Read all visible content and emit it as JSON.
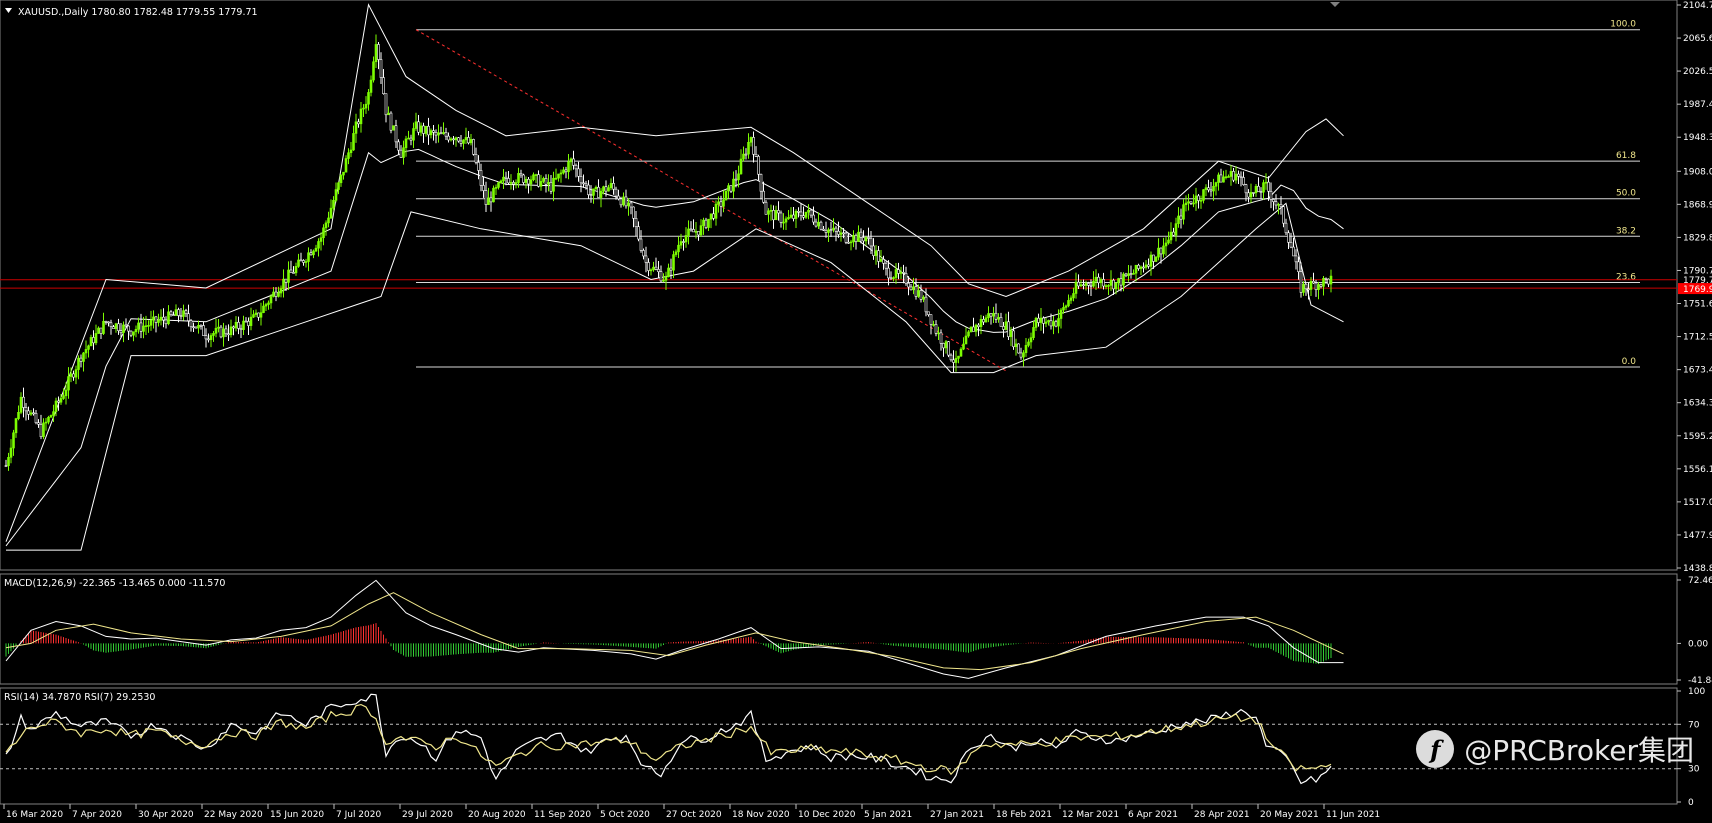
{
  "chart_data": [
    {
      "type": "candlestick",
      "title": "XAUUSD.,Daily  1780.80 1782.48 1779.55 1779.71",
      "ylim": [
        1438.85,
        2104.7
      ],
      "y_ticks": [
        "2104.70",
        "2065.60",
        "2026.55",
        "1987.40",
        "1948.30",
        "1908.05",
        "1868.95",
        "1829.85",
        "1790.75",
        "1751.65",
        "1712.55",
        "1673.45",
        "1634.35",
        "1595.25",
        "1556.15",
        "1517.05",
        "1477.95",
        "1438.85"
      ],
      "x_ticks": [
        "16 Mar 2020",
        "7 Apr 2020",
        "30 Apr 2020",
        "22 May 2020",
        "15 Jun 2020",
        "7 Jul 2020",
        "29 Jul 2020",
        "20 Aug 2020",
        "11 Sep 2020",
        "5 Oct 2020",
        "27 Oct 2020",
        "18 Nov 2020",
        "10 Dec 2020",
        "5 Jan 2021",
        "27 Jan 2021",
        "18 Feb 2021",
        "12 Mar 2021",
        "6 Apr 2021",
        "28 Apr 2021",
        "20 May 2021",
        "11 Jun 2021"
      ],
      "price_path": [
        [
          0,
          1560
        ],
        [
          6,
          1640
        ],
        [
          14,
          1600
        ],
        [
          22,
          1640
        ],
        [
          30,
          1690
        ],
        [
          40,
          1730
        ],
        [
          50,
          1720
        ],
        [
          60,
          1730
        ],
        [
          70,
          1740
        ],
        [
          80,
          1715
        ],
        [
          90,
          1720
        ],
        [
          100,
          1735
        ],
        [
          110,
          1775
        ],
        [
          118,
          1800
        ],
        [
          126,
          1830
        ],
        [
          134,
          1900
        ],
        [
          140,
          1960
        ],
        [
          145,
          2000
        ],
        [
          148,
          2065
        ],
        [
          152,
          1980
        ],
        [
          158,
          1930
        ],
        [
          164,
          1960
        ],
        [
          172,
          1950
        ],
        [
          180,
          1950
        ],
        [
          186,
          1940
        ],
        [
          192,
          1870
        ],
        [
          200,
          1900
        ],
        [
          210,
          1900
        ],
        [
          218,
          1890
        ],
        [
          226,
          1920
        ],
        [
          234,
          1880
        ],
        [
          242,
          1890
        ],
        [
          250,
          1860
        ],
        [
          256,
          1800
        ],
        [
          264,
          1780
        ],
        [
          270,
          1830
        ],
        [
          278,
          1840
        ],
        [
          286,
          1870
        ],
        [
          292,
          1900
        ],
        [
          298,
          1950
        ],
        [
          304,
          1860
        ],
        [
          312,
          1850
        ],
        [
          320,
          1860
        ],
        [
          328,
          1840
        ],
        [
          336,
          1830
        ],
        [
          344,
          1830
        ],
        [
          352,
          1790
        ],
        [
          360,
          1780
        ],
        [
          366,
          1760
        ],
        [
          372,
          1720
        ],
        [
          380,
          1680
        ],
        [
          386,
          1720
        ],
        [
          394,
          1740
        ],
        [
          400,
          1725
        ],
        [
          406,
          1690
        ],
        [
          412,
          1730
        ],
        [
          420,
          1730
        ],
        [
          428,
          1770
        ],
        [
          436,
          1780
        ],
        [
          444,
          1775
        ],
        [
          452,
          1790
        ],
        [
          460,
          1810
        ],
        [
          466,
          1830
        ],
        [
          472,
          1870
        ],
        [
          478,
          1880
        ],
        [
          486,
          1900
        ],
        [
          492,
          1905
        ],
        [
          498,
          1880
        ],
        [
          504,
          1890
        ],
        [
          510,
          1860
        ],
        [
          514,
          1820
        ],
        [
          518,
          1770
        ],
        [
          524,
          1775
        ],
        [
          530,
          1780
        ]
      ],
      "bollinger": {
        "upper": [
          [
            0,
            1470
          ],
          [
            40,
            1780
          ],
          [
            80,
            1770
          ],
          [
            130,
            1840
          ],
          [
            145,
            2105
          ],
          [
            160,
            2020
          ],
          [
            180,
            1980
          ],
          [
            200,
            1950
          ],
          [
            230,
            1960
          ],
          [
            260,
            1950
          ],
          [
            298,
            1960
          ],
          [
            315,
            1930
          ],
          [
            345,
            1870
          ],
          [
            370,
            1820
          ],
          [
            385,
            1775
          ],
          [
            400,
            1760
          ],
          [
            425,
            1790
          ],
          [
            455,
            1840
          ],
          [
            485,
            1920
          ],
          [
            505,
            1900
          ],
          [
            520,
            1955
          ],
          [
            528,
            1970
          ],
          [
            535,
            1950
          ]
        ],
        "lower": [
          [
            0,
            1460
          ],
          [
            30,
            1460
          ],
          [
            50,
            1690
          ],
          [
            80,
            1690
          ],
          [
            120,
            1730
          ],
          [
            140,
            1750
          ],
          [
            150,
            1760
          ],
          [
            162,
            1860
          ],
          [
            190,
            1840
          ],
          [
            230,
            1820
          ],
          [
            258,
            1780
          ],
          [
            275,
            1790
          ],
          [
            300,
            1840
          ],
          [
            330,
            1800
          ],
          [
            360,
            1730
          ],
          [
            378,
            1670
          ],
          [
            395,
            1670
          ],
          [
            412,
            1690
          ],
          [
            440,
            1700
          ],
          [
            470,
            1760
          ],
          [
            500,
            1840
          ],
          [
            512,
            1870
          ],
          [
            522,
            1750
          ],
          [
            535,
            1730
          ]
        ]
      },
      "fibonacci": [
        {
          "level": "100.0",
          "price": 2075.5
        },
        {
          "level": "61.8",
          "price": 1920.0
        },
        {
          "level": "50.0",
          "price": 1875.6
        },
        {
          "level": "38.2",
          "price": 1831.2
        },
        {
          "level": "23.6",
          "price": 1776.5
        },
        {
          "level": "0.0",
          "price": 1676.5
        }
      ],
      "price_labels": [
        "1779.71",
        "1769.92"
      ],
      "colors": {
        "bull": "#7cfc00",
        "bear": "#ffffff",
        "bollinger": "#ffffff",
        "fib": "#f0e68c",
        "price_line": "#ff0000"
      }
    },
    {
      "type": "macd",
      "title": "MACD(12,26,9) -22.365 -13.465 0.000 -11.570",
      "ylim": [
        -41.849,
        72.462
      ],
      "y_ticks": [
        "72.462",
        "0.00",
        "-41.849"
      ],
      "macd": [
        [
          0,
          -20
        ],
        [
          10,
          15
        ],
        [
          20,
          25
        ],
        [
          30,
          20
        ],
        [
          40,
          8
        ],
        [
          50,
          5
        ],
        [
          60,
          6
        ],
        [
          70,
          2
        ],
        [
          80,
          -2
        ],
        [
          90,
          4
        ],
        [
          100,
          6
        ],
        [
          110,
          15
        ],
        [
          120,
          18
        ],
        [
          130,
          30
        ],
        [
          140,
          55
        ],
        [
          148,
          72
        ],
        [
          160,
          35
        ],
        [
          170,
          20
        ],
        [
          180,
          10
        ],
        [
          195,
          -6
        ],
        [
          205,
          -10
        ],
        [
          215,
          -5
        ],
        [
          235,
          -8
        ],
        [
          250,
          -12
        ],
        [
          260,
          -18
        ],
        [
          270,
          -8
        ],
        [
          285,
          5
        ],
        [
          298,
          18
        ],
        [
          310,
          -6
        ],
        [
          325,
          -4
        ],
        [
          345,
          -9
        ],
        [
          360,
          -22
        ],
        [
          375,
          -35
        ],
        [
          385,
          -40
        ],
        [
          400,
          -28
        ],
        [
          420,
          -14
        ],
        [
          440,
          8
        ],
        [
          460,
          20
        ],
        [
          480,
          30
        ],
        [
          495,
          30
        ],
        [
          505,
          20
        ],
        [
          515,
          -5
        ],
        [
          525,
          -22
        ],
        [
          535,
          -22
        ]
      ],
      "signal": [
        [
          0,
          -5
        ],
        [
          10,
          0
        ],
        [
          20,
          15
        ],
        [
          35,
          22
        ],
        [
          50,
          12
        ],
        [
          70,
          5
        ],
        [
          90,
          2
        ],
        [
          110,
          8
        ],
        [
          130,
          20
        ],
        [
          145,
          45
        ],
        [
          155,
          58
        ],
        [
          170,
          35
        ],
        [
          190,
          10
        ],
        [
          205,
          -6
        ],
        [
          225,
          -6
        ],
        [
          250,
          -8
        ],
        [
          265,
          -14
        ],
        [
          280,
          -2
        ],
        [
          300,
          12
        ],
        [
          315,
          2
        ],
        [
          335,
          -6
        ],
        [
          355,
          -15
        ],
        [
          375,
          -28
        ],
        [
          390,
          -30
        ],
        [
          410,
          -22
        ],
        [
          430,
          -6
        ],
        [
          455,
          10
        ],
        [
          480,
          25
        ],
        [
          500,
          30
        ],
        [
          515,
          15
        ],
        [
          535,
          -12
        ]
      ],
      "colors": {
        "macd": "#ffffff",
        "signal": "#f0e68c",
        "hist_pos": "#ff3030",
        "hist_neg": "#32cd32"
      }
    },
    {
      "type": "rsi",
      "title": "RSI(14) 34.7870  RSI(7) 29.2530",
      "ylim": [
        0,
        100
      ],
      "y_ticks": [
        "100",
        "70",
        "30",
        "0"
      ],
      "rsi7": [
        [
          0,
          40
        ],
        [
          6,
          75
        ],
        [
          10,
          65
        ],
        [
          20,
          80
        ],
        [
          30,
          68
        ],
        [
          40,
          72
        ],
        [
          50,
          60
        ],
        [
          60,
          70
        ],
        [
          70,
          58
        ],
        [
          80,
          48
        ],
        [
          90,
          70
        ],
        [
          100,
          62
        ],
        [
          110,
          80
        ],
        [
          120,
          70
        ],
        [
          130,
          85
        ],
        [
          140,
          92
        ],
        [
          148,
          95
        ],
        [
          152,
          45
        ],
        [
          158,
          60
        ],
        [
          165,
          55
        ],
        [
          172,
          40
        ],
        [
          180,
          65
        ],
        [
          190,
          58
        ],
        [
          196,
          20
        ],
        [
          204,
          45
        ],
        [
          212,
          55
        ],
        [
          222,
          60
        ],
        [
          232,
          45
        ],
        [
          240,
          55
        ],
        [
          248,
          60
        ],
        [
          256,
          30
        ],
        [
          262,
          25
        ],
        [
          270,
          55
        ],
        [
          280,
          58
        ],
        [
          292,
          70
        ],
        [
          298,
          78
        ],
        [
          304,
          38
        ],
        [
          312,
          45
        ],
        [
          322,
          50
        ],
        [
          330,
          40
        ],
        [
          338,
          42
        ],
        [
          346,
          40
        ],
        [
          354,
          35
        ],
        [
          362,
          30
        ],
        [
          370,
          22
        ],
        [
          378,
          20
        ],
        [
          386,
          50
        ],
        [
          394,
          60
        ],
        [
          402,
          48
        ],
        [
          410,
          55
        ],
        [
          420,
          50
        ],
        [
          428,
          62
        ],
        [
          436,
          58
        ],
        [
          444,
          55
        ],
        [
          452,
          60
        ],
        [
          460,
          62
        ],
        [
          468,
          70
        ],
        [
          476,
          72
        ],
        [
          484,
          75
        ],
        [
          492,
          82
        ],
        [
          500,
          78
        ],
        [
          504,
          50
        ],
        [
          512,
          40
        ],
        [
          518,
          18
        ],
        [
          524,
          20
        ],
        [
          530,
          30
        ]
      ],
      "rsi14": [
        [
          0,
          45
        ],
        [
          10,
          68
        ],
        [
          20,
          72
        ],
        [
          30,
          62
        ],
        [
          40,
          66
        ],
        [
          50,
          60
        ],
        [
          60,
          64
        ],
        [
          70,
          55
        ],
        [
          80,
          52
        ],
        [
          90,
          63
        ],
        [
          100,
          60
        ],
        [
          110,
          72
        ],
        [
          120,
          66
        ],
        [
          130,
          78
        ],
        [
          145,
          86
        ],
        [
          152,
          55
        ],
        [
          158,
          58
        ],
        [
          172,
          50
        ],
        [
          180,
          60
        ],
        [
          196,
          32
        ],
        [
          212,
          50
        ],
        [
          230,
          52
        ],
        [
          248,
          56
        ],
        [
          260,
          38
        ],
        [
          270,
          50
        ],
        [
          290,
          62
        ],
        [
          298,
          68
        ],
        [
          306,
          44
        ],
        [
          322,
          48
        ],
        [
          340,
          44
        ],
        [
          356,
          38
        ],
        [
          370,
          30
        ],
        [
          380,
          28
        ],
        [
          390,
          52
        ],
        [
          410,
          52
        ],
        [
          430,
          58
        ],
        [
          450,
          60
        ],
        [
          470,
          68
        ],
        [
          490,
          76
        ],
        [
          500,
          74
        ],
        [
          506,
          52
        ],
        [
          516,
          30
        ],
        [
          524,
          30
        ],
        [
          530,
          34
        ]
      ],
      "levels": [
        70,
        30
      ],
      "colors": {
        "rsi7": "#ffffff",
        "rsi14": "#f0e68c"
      }
    }
  ],
  "watermark": {
    "icon": "weibo-style-f-icon",
    "glyph": "f",
    "text": "@PRCBroker集团"
  }
}
